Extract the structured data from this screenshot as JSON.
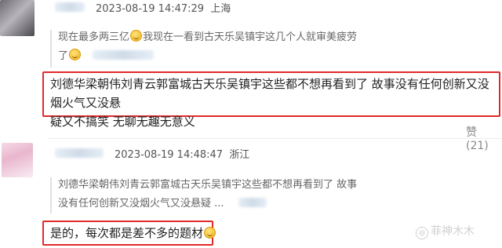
{
  "comment1": {
    "timestamp": "2023-08-19 14:47:29",
    "location": "上海",
    "quoted_line1": "现在最多两三亿",
    "quoted_line1b": "我现在一看到古天乐吴镇宇这几个人就审美疲劳",
    "quoted_line2": "了",
    "reply_line1": "刘德华梁朝伟刘青云郭富城古天乐吴镇宇这些都不想再看到了 故事没有任何创新又没烟火气又没悬",
    "reply_line2": "疑又不搞笑 无聊无趣无意义",
    "like_label": "赞",
    "like_count": "(21)"
  },
  "comment2": {
    "timestamp": "2023-08-19 14:48:47",
    "location": "浙江",
    "quoted_line1": "刘德华梁朝伟刘青云郭富城古天乐吴镇宇这些都不想再看到了 故事",
    "quoted_line2": "没有任何创新又没烟火气又没悬疑 ...",
    "reply": "是的，每次都是差不多的题材"
  },
  "watermark": {
    "icon": "@",
    "text": "菲神木木"
  }
}
